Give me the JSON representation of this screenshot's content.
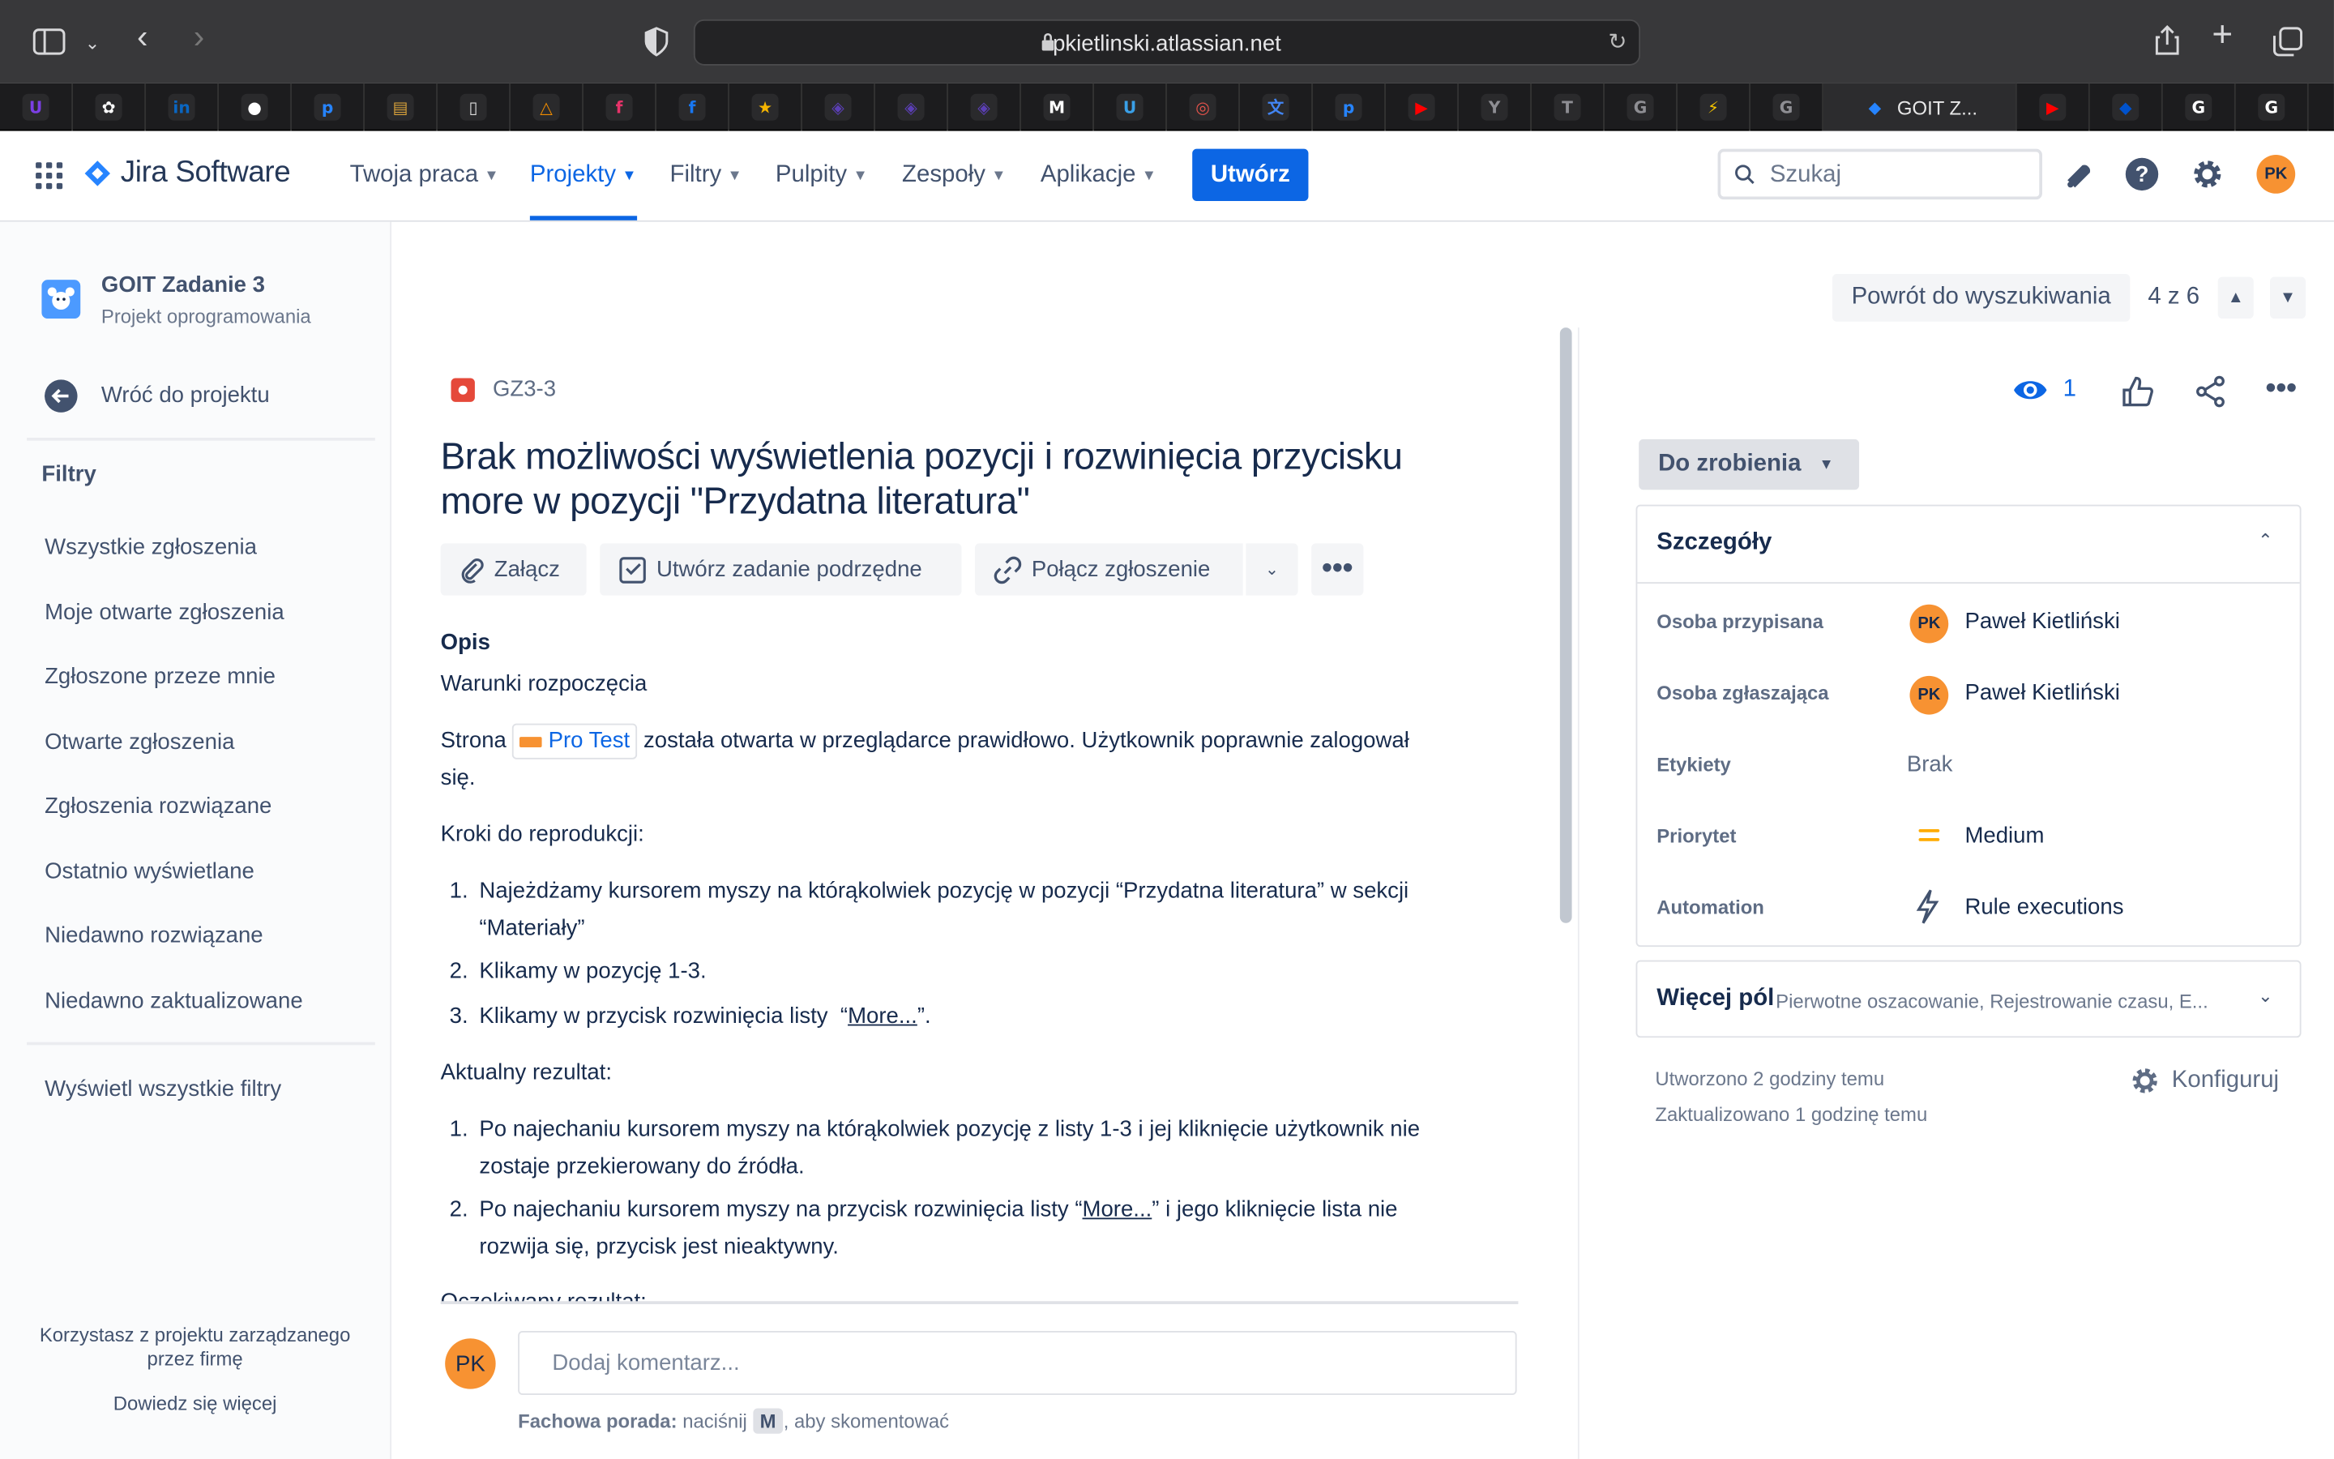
{
  "browser": {
    "url": "pkietlinski.atlassian.net",
    "active_tab_label": "GOIT Z...",
    "favicons": [
      {
        "name": "u-icon",
        "color": "#7b3fe4",
        "glyph": "U"
      },
      {
        "name": "chatgpt-icon",
        "color": "#ffffff",
        "glyph": "✿"
      },
      {
        "name": "linkedin-icon",
        "color": "#0a66c2",
        "glyph": "in"
      },
      {
        "name": "github-icon",
        "color": "#ffffff",
        "glyph": "●"
      },
      {
        "name": "p-icon",
        "color": "#2684ff",
        "glyph": "p"
      },
      {
        "name": "note-icon",
        "color": "#d7a13a",
        "glyph": "▤"
      },
      {
        "name": "book-icon",
        "color": "#dddddd",
        "glyph": "▯"
      },
      {
        "name": "triangle-icon",
        "color": "#f08c00",
        "glyph": "△"
      },
      {
        "name": "f-icon",
        "color": "#e8336a",
        "glyph": "f"
      },
      {
        "name": "facebook-icon",
        "color": "#1877f2",
        "glyph": "f"
      },
      {
        "name": "star-icon",
        "color": "#f5b400",
        "glyph": "★"
      },
      {
        "name": "shield-icon",
        "color": "#5b3fb5",
        "glyph": "◈"
      },
      {
        "name": "shield-icon",
        "color": "#5b3fb5",
        "glyph": "◈"
      },
      {
        "name": "shield-icon",
        "color": "#5b3fb5",
        "glyph": "◈"
      },
      {
        "name": "m-icon",
        "color": "#ffffff",
        "glyph": "M"
      },
      {
        "name": "u-circle-icon",
        "color": "#3aa0e8",
        "glyph": "U"
      },
      {
        "name": "brain-icon",
        "color": "#e5534b",
        "glyph": "◎"
      },
      {
        "name": "translate-icon",
        "color": "#4285f4",
        "glyph": "文"
      },
      {
        "name": "p-icon",
        "color": "#2684ff",
        "glyph": "p"
      },
      {
        "name": "youtube-icon",
        "color": "#ff0000",
        "glyph": "▶"
      },
      {
        "name": "y-icon",
        "color": "#8e8e93",
        "glyph": "Y"
      },
      {
        "name": "t-icon",
        "color": "#8e8e93",
        "glyph": "T"
      },
      {
        "name": "g-icon",
        "color": "#8e8e93",
        "glyph": "G"
      },
      {
        "name": "bolt-icon",
        "color": "#f5c400",
        "glyph": "⚡"
      },
      {
        "name": "g-icon",
        "color": "#8e8e93",
        "glyph": "G"
      },
      {
        "name": "jira-icon",
        "color": "#2684ff",
        "glyph": "◆"
      },
      {
        "name": "youtube-icon",
        "color": "#ff0000",
        "glyph": "▶"
      },
      {
        "name": "jira-blue-icon",
        "color": "#0052cc",
        "glyph": "◆"
      },
      {
        "name": "google-icon",
        "color": "#ffffff",
        "glyph": "G"
      },
      {
        "name": "google-icon",
        "color": "#ffffff",
        "glyph": "G"
      }
    ]
  },
  "header": {
    "product": "Jira Software",
    "nav": [
      "Twoja praca",
      "Projekty",
      "Filtry",
      "Pulpity",
      "Zespoły",
      "Aplikacje"
    ],
    "create_label": "Utwórz",
    "search_placeholder": "Szukaj",
    "avatar_initials": "PK"
  },
  "sidebar": {
    "project_name": "GOIT Zadanie 3",
    "project_type": "Projekt oprogramowania",
    "back_label": "Wróć do projektu",
    "filters_heading": "Filtry",
    "filters": [
      "Wszystkie zgłoszenia",
      "Moje otwarte zgłoszenia",
      "Zgłoszone przeze mnie",
      "Otwarte zgłoszenia",
      "Zgłoszenia rozwiązane",
      "Ostatnio wyświetlane",
      "Niedawno rozwiązane",
      "Niedawno zaktualizowane"
    ],
    "all_filters_label": "Wyświetl wszystkie filtry",
    "footer_text_1": "Korzystasz z projektu zarządzanego",
    "footer_text_2": "przez firmę",
    "footer_link": "Dowiedz się więcej"
  },
  "issue": {
    "key": "GZ3-3",
    "title_line1": "Brak możliwości wyświetlenia pozycji i rozwinięcia przycisku",
    "title_line2": "more w pozycji \"Przydatna literatura\"",
    "toolbar": {
      "attach": "Załącz",
      "subtask": "Utwórz zadanie podrzędne",
      "link": "Połącz zgłoszenie"
    },
    "description": {
      "heading": "Opis",
      "conditions": "Warunki rozpoczęcia",
      "para_a": "Strona",
      "pro_test": "Pro Test",
      "para_b": "została otwarta w przeglądarce prawidłowo. Użytkownik poprawnie zalogował",
      "para_c": "się.",
      "steps_heading": "Kroki do reprodukcji:",
      "steps": [
        {
          "n": "1.",
          "line1": "Najeżdżamy kursorem myszy na którąkolwiek pozycję w pozycji “Przydatna literatura” w sekcji",
          "line2": "“Materiały”"
        },
        {
          "n": "2.",
          "line1": "Klikamy w pozycję 1-3."
        },
        {
          "n": "3.",
          "pre": "Klikamy w przycisk rozwinięcia listy  “",
          "link": "More...",
          "post": "”."
        }
      ],
      "actual_heading": "Aktualny rezultat:",
      "actual": [
        {
          "n": "1.",
          "line1": "Po najechaniu kursorem myszy na którąkolwiek pozycję z listy 1-3 i jej kliknięcie użytkownik nie",
          "line2": "zostaje przekierowany do źródła."
        },
        {
          "n": "2.",
          "pre": "Po najechaniu kursorem myszy na przycisk rozwinięcia listy “",
          "link": "More...",
          "post": "” i jego kliknięcie lista nie",
          "line2": "rozwija się, przycisk jest nieaktywny."
        }
      ],
      "expected_heading_partial": "Oczekiwany rezultat:"
    },
    "comment": {
      "avatar": "PK",
      "placeholder": "Dodaj komentarz...",
      "tip_bold": "Fachowa porada:",
      "tip_pre": " naciśnij ",
      "tip_key": "M",
      "tip_post": ", aby skomentować"
    }
  },
  "panel": {
    "back_to_search": "Powrót do wyszukiwania",
    "position": "4 z 6",
    "watchers": "1",
    "status": "Do zrobienia",
    "details_heading": "Szczegóły",
    "fields": {
      "assignee_label": "Osoba przypisana",
      "assignee": "Paweł Kietliński",
      "reporter_label": "Osoba zgłaszająca",
      "reporter": "Paweł Kietliński",
      "labels_label": "Etykiety",
      "labels": "Brak",
      "priority_label": "Priorytet",
      "priority": "Medium",
      "automation_label": "Automation",
      "automation": "Rule executions"
    },
    "more_fields": "Więcej pól",
    "more_fields_sub": "Pierwotne oszacowanie, Rejestrowanie czasu, E...",
    "created": "Utworzono 2 godziny temu",
    "updated": "Zaktualizowano 1 godzinę temu",
    "configure": "Konfiguruj",
    "avatar_initials": "PK"
  },
  "colors": {
    "primary": "#0c66e4",
    "avatar": "#f79232",
    "bug": "#e5493a"
  }
}
